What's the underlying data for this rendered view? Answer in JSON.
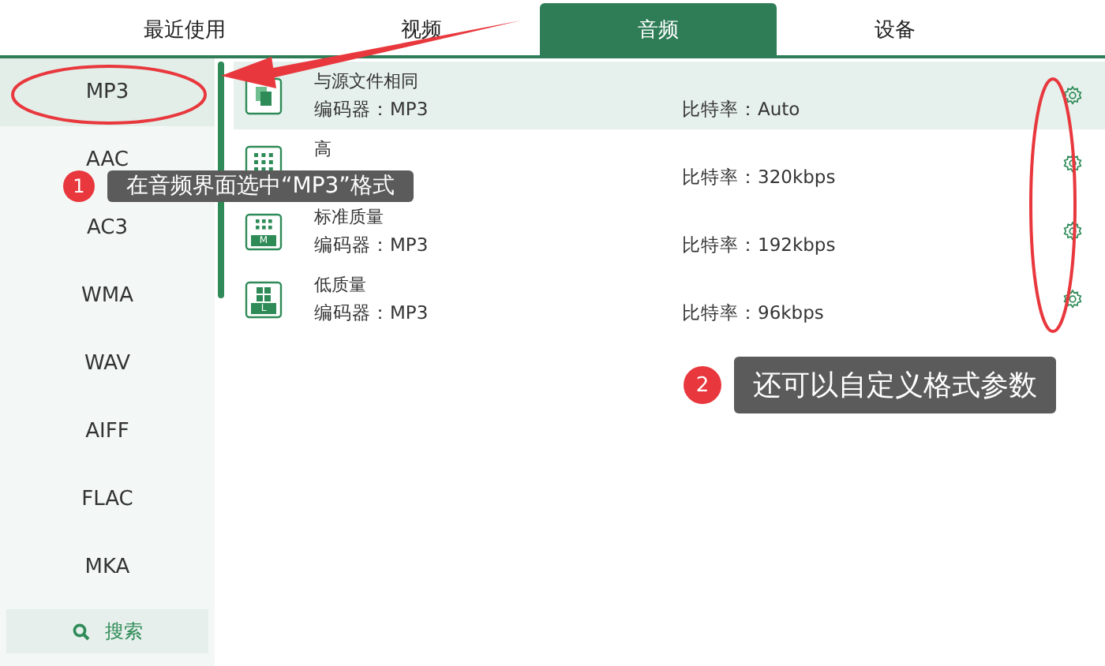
{
  "tabs": [
    {
      "label": "最近使用",
      "selected": false
    },
    {
      "label": "视频",
      "selected": false
    },
    {
      "label": "音频",
      "selected": true
    },
    {
      "label": "设备",
      "selected": false
    }
  ],
  "sidebar": {
    "items": [
      {
        "label": "MP3",
        "selected": true
      },
      {
        "label": "AAC",
        "selected": false
      },
      {
        "label": "AC3",
        "selected": false
      },
      {
        "label": "WMA",
        "selected": false
      },
      {
        "label": "WAV",
        "selected": false
      },
      {
        "label": "AIFF",
        "selected": false
      },
      {
        "label": "FLAC",
        "selected": false
      },
      {
        "label": "MKA",
        "selected": false
      }
    ],
    "search_button": "搜索"
  },
  "presets": [
    {
      "name": "与源文件相同",
      "codec": "编码器：MP3",
      "bitrate": "比特率：Auto",
      "kind": "copy",
      "selected": true
    },
    {
      "name": "高",
      "bitrate": "比特率：320kbps",
      "kind": "high",
      "selected": false
    },
    {
      "name": "标准质量",
      "codec": "编码器：MP3",
      "bitrate": "比特率：192kbps",
      "kind": "medium",
      "badge": "M",
      "selected": false
    },
    {
      "name": "低质量",
      "codec": "编码器：MP3",
      "bitrate": "比特率：96kbps",
      "kind": "low",
      "badge": "L",
      "selected": false
    }
  ],
  "callouts": [
    {
      "number": "1",
      "text": "在音频界面选中“MP3”格式"
    },
    {
      "number": "2",
      "text": "还可以自定义格式参数"
    }
  ]
}
